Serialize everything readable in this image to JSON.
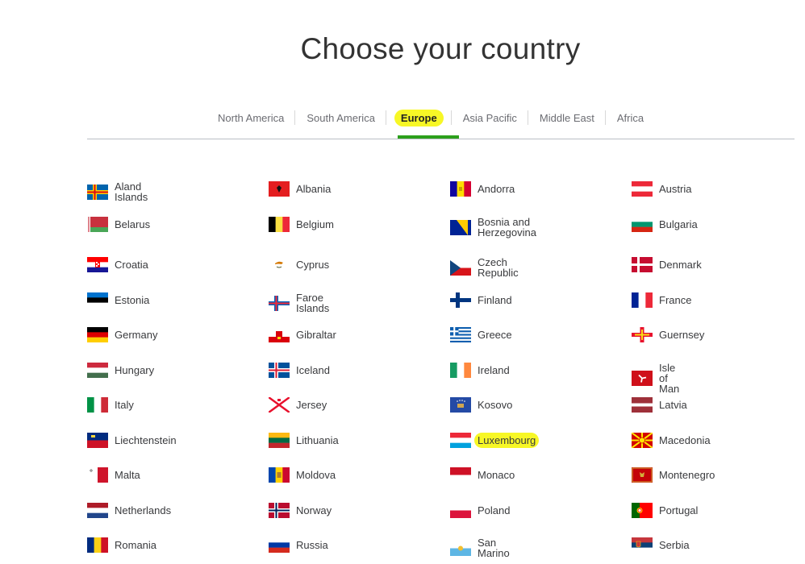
{
  "page": {
    "title": "Choose your country"
  },
  "tabs": [
    {
      "label": "North America"
    },
    {
      "label": "South America"
    },
    {
      "label": "Europe",
      "active": true
    },
    {
      "label": "Asia Pacific"
    },
    {
      "label": "Middle East"
    },
    {
      "label": "Africa"
    }
  ],
  "colors": {
    "accent": "#2ca01c",
    "highlight": "#f7f726"
  },
  "countries": [
    {
      "name": "Aland Islands",
      "flag": "aland-flag-icon"
    },
    {
      "name": "Albania",
      "flag": "albania-flag-icon"
    },
    {
      "name": "Andorra",
      "flag": "andorra-flag-icon"
    },
    {
      "name": "Austria",
      "flag": "austria-flag-icon"
    },
    {
      "name": "Belarus",
      "flag": "belarus-flag-icon"
    },
    {
      "name": "Belgium",
      "flag": "belgium-flag-icon"
    },
    {
      "name": "Bosnia and Herzegovina",
      "flag": "bosnia-flag-icon"
    },
    {
      "name": "Bulgaria",
      "flag": "bulgaria-flag-icon"
    },
    {
      "name": "Croatia",
      "flag": "croatia-flag-icon"
    },
    {
      "name": "Cyprus",
      "flag": "cyprus-flag-icon"
    },
    {
      "name": "Czech Republic",
      "flag": "czech-flag-icon"
    },
    {
      "name": "Denmark",
      "flag": "denmark-flag-icon"
    },
    {
      "name": "Estonia",
      "flag": "estonia-flag-icon"
    },
    {
      "name": "Faroe Islands",
      "flag": "faroe-flag-icon"
    },
    {
      "name": "Finland",
      "flag": "finland-flag-icon"
    },
    {
      "name": "France",
      "flag": "france-flag-icon"
    },
    {
      "name": "Germany",
      "flag": "germany-flag-icon"
    },
    {
      "name": "Gibraltar",
      "flag": "gibraltar-flag-icon"
    },
    {
      "name": "Greece",
      "flag": "greece-flag-icon"
    },
    {
      "name": "Guernsey",
      "flag": "guernsey-flag-icon"
    },
    {
      "name": "Hungary",
      "flag": "hungary-flag-icon"
    },
    {
      "name": "Iceland",
      "flag": "iceland-flag-icon"
    },
    {
      "name": "Ireland",
      "flag": "ireland-flag-icon"
    },
    {
      "name": "Isle of Man",
      "flag": "isle-of-man-flag-icon"
    },
    {
      "name": "Italy",
      "flag": "italy-flag-icon"
    },
    {
      "name": "Jersey",
      "flag": "jersey-flag-icon"
    },
    {
      "name": "Kosovo",
      "flag": "kosovo-flag-icon"
    },
    {
      "name": "Latvia",
      "flag": "latvia-flag-icon"
    },
    {
      "name": "Liechtenstein",
      "flag": "liechtenstein-flag-icon"
    },
    {
      "name": "Lithuania",
      "flag": "lithuania-flag-icon"
    },
    {
      "name": "Luxembourg",
      "flag": "luxembourg-flag-icon",
      "highlighted": true
    },
    {
      "name": "Macedonia",
      "flag": "macedonia-flag-icon"
    },
    {
      "name": "Malta",
      "flag": "malta-flag-icon"
    },
    {
      "name": "Moldova",
      "flag": "moldova-flag-icon"
    },
    {
      "name": "Monaco",
      "flag": "monaco-flag-icon"
    },
    {
      "name": "Montenegro",
      "flag": "montenegro-flag-icon"
    },
    {
      "name": "Netherlands",
      "flag": "netherlands-flag-icon"
    },
    {
      "name": "Norway",
      "flag": "norway-flag-icon"
    },
    {
      "name": "Poland",
      "flag": "poland-flag-icon"
    },
    {
      "name": "Portugal",
      "flag": "portugal-flag-icon"
    },
    {
      "name": "Romania",
      "flag": "romania-flag-icon"
    },
    {
      "name": "Russia",
      "flag": "russia-flag-icon"
    },
    {
      "name": "San Marino",
      "flag": "san-marino-flag-icon"
    },
    {
      "name": "Serbia",
      "flag": "serbia-flag-icon"
    }
  ]
}
